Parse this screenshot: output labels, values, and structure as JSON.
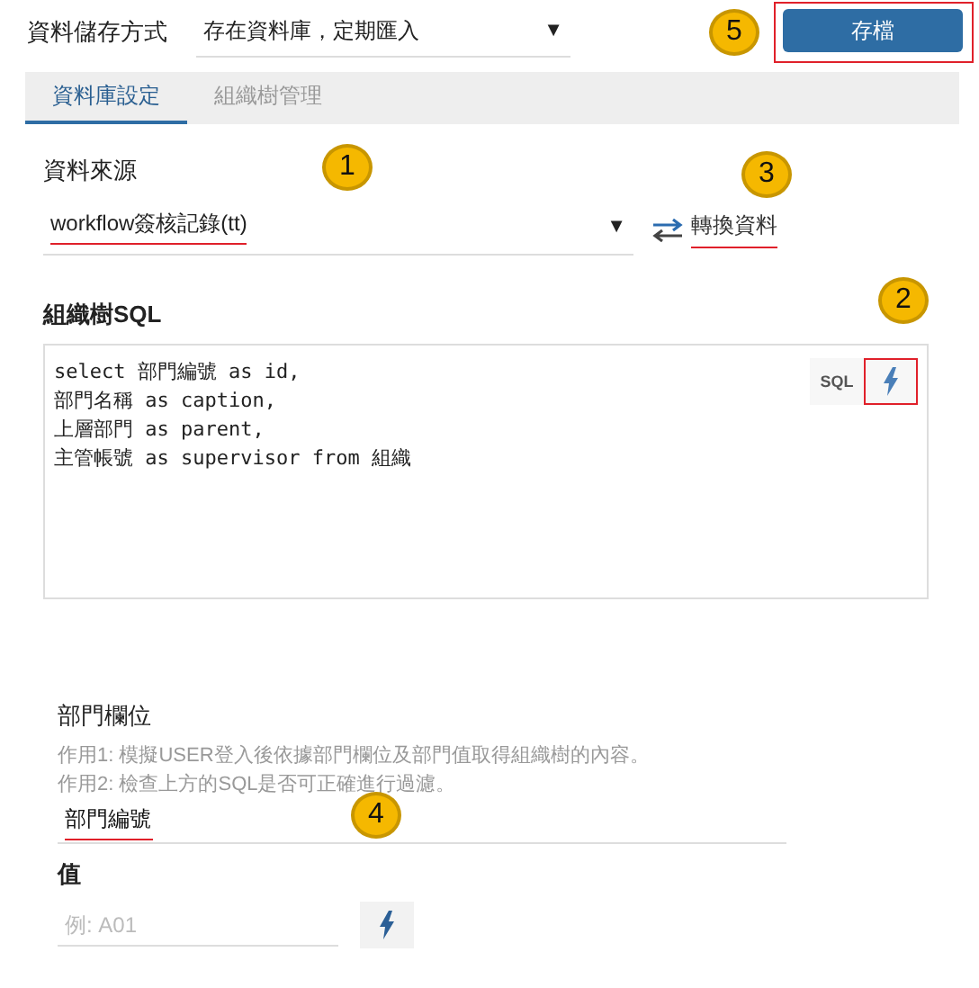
{
  "storage": {
    "label": "資料儲存方式",
    "value": "存在資料庫，定期匯入",
    "arrow": "▼"
  },
  "save_button": {
    "label": "存檔",
    "highlighted": true
  },
  "tabs": [
    {
      "label": "資料庫設定",
      "selected": true
    },
    {
      "label": "組織樹管理",
      "selected": false
    }
  ],
  "source": {
    "label": "資料來源",
    "value": "workflow簽核記錄(tt)",
    "arrow": "▼",
    "highlighted": true
  },
  "convert_link": {
    "label": "轉換資料",
    "highlighted": true
  },
  "sql": {
    "label": "組織樹SQL",
    "lines": [
      "select 部門編號 as id,",
      "部門名稱 as caption,",
      "上層部門 as parent,",
      "主管帳號 as supervisor from 組織"
    ],
    "sql_button": "SQL",
    "run_highlighted": true
  },
  "department": {
    "label": "部門欄位",
    "help": [
      "作用1: 模擬USER登入後依據部門欄位及部門值取得組織樹的內容。",
      "作用2: 檢查上方的SQL是否可正確進行過濾。"
    ],
    "value": "部門編號",
    "highlighted": true
  },
  "value_field": {
    "label": "值",
    "placeholder": "例: A01"
  },
  "callouts": [
    "5",
    "1",
    "3",
    "2",
    "4"
  ]
}
